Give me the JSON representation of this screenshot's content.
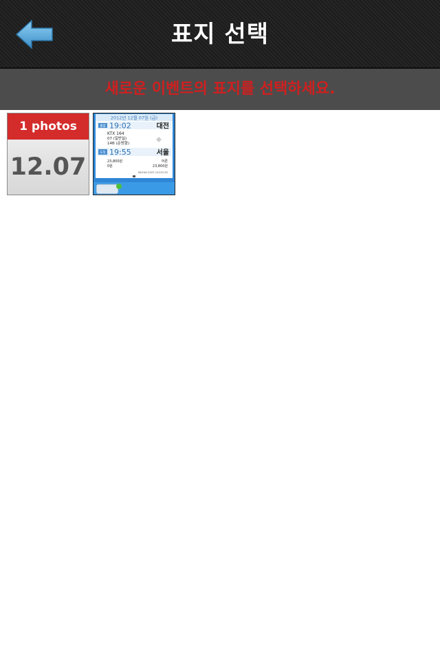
{
  "header": {
    "title": "표지 선택"
  },
  "banner": {
    "message": "새로운 이벤트의 표지를 선택하세요."
  },
  "colors": {
    "accent_red": "#d42b2b",
    "banner_bg": "#4c4c4c",
    "back_arrow": "#5aaee0"
  },
  "grid": {
    "date_tile": {
      "count_label": "1 photos",
      "date": "12.07"
    },
    "photo_tile": {
      "ticket": {
        "date_line": "2012년 12월 07일 (금)",
        "depart_badge": "출발",
        "depart_time": "19:02",
        "depart_city": "대전",
        "train": "KTX 164",
        "car": "07 (일반실)",
        "seat": "14B (순방향)",
        "arrive_badge": "도착",
        "arrive_time": "19:55",
        "arrive_city": "서울",
        "fare": "23,800원",
        "discount": "0원",
        "type": "어른",
        "total": "23,800원",
        "serial": "80194-1207-11123-32"
      }
    }
  }
}
